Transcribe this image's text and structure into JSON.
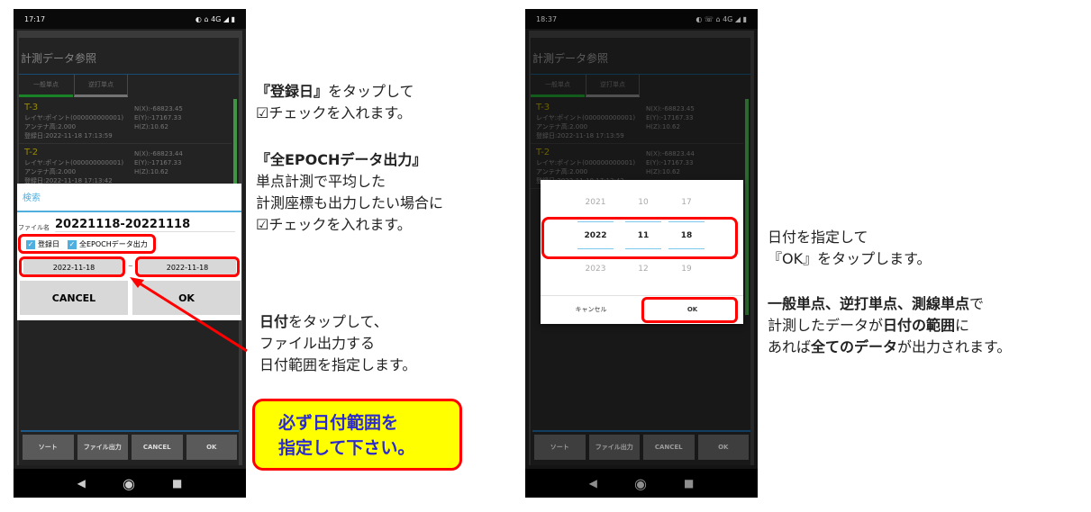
{
  "phones": [
    {
      "time": "17:17",
      "status_right": "◐ ⌂ 4G ◢ ▮"
    },
    {
      "time": "18:37",
      "status_right": "◐ ☏ ⌂ 4G ◢ ▮"
    }
  ],
  "app": {
    "title": "計測データ参照",
    "tabs": [
      "一般単点",
      "逆打単点"
    ],
    "items": [
      {
        "name": "T-3",
        "layer": "レイヤ:ポイント(000000000001)",
        "antenna": "アンテナ高:2.000",
        "date": "登録日:2022-11-18 17:13:59",
        "n": "N(X):-68823.45",
        "e": "E(Y):-17167.33",
        "h": "H(Z):10.62"
      },
      {
        "name": "T-2",
        "layer": "レイヤ:ポイント(000000000001)",
        "antenna": "アンテナ高:2.000",
        "date": "登録日:2022-11-18 17:13:42",
        "n": "N(X):-68823.44",
        "e": "E(Y):-17167.33",
        "h": "H(Z):10.62"
      }
    ],
    "bottom_buttons": [
      "ソート",
      "ファイル出力",
      "CANCEL",
      "OK"
    ]
  },
  "search_dialog": {
    "title": "検索",
    "filename_label": "ファイル名",
    "filename": "20221118-20221118",
    "check_date": "登録日",
    "check_epoch": "全EPOCHデータ出力",
    "date_from": "2022-11-18",
    "tilde": "~",
    "date_to": "2022-11-18",
    "cancel": "CANCEL",
    "ok": "OK"
  },
  "date_picker": {
    "prev": [
      "2021",
      "10",
      "17"
    ],
    "selected": [
      "2022",
      "11",
      "18"
    ],
    "next": [
      "2023",
      "12",
      "19"
    ],
    "cancel": "キャンセル",
    "ok": "OK"
  },
  "notes": {
    "n1a": "『登録日』",
    "n1b": "をタップして",
    "n1c": "☑チェックを入れます。",
    "n2a": "『全EPOCHデータ出力』",
    "n2b": "単点計測で平均した",
    "n2c": "計測座標も出力したい場合に",
    "n2d": "☑チェックを入れます。",
    "n3a": "日付",
    "n3b": "をタップして、",
    "n3c": "ファイル出力する",
    "n3d": "日付範囲を指定します。",
    "warn1": "必ず日付範囲を",
    "warn2": "指定して下さい。",
    "r1": "日付を指定して",
    "r2": "『OK』をタップします。",
    "r3a": "一般単点、逆打単点、測線単点",
    "r3b": "で",
    "r4a": "計測したデータが",
    "r4b": "日付の範囲",
    "r4c": "に",
    "r5a": "あれば",
    "r5b": "全てのデータ",
    "r5c": "が出力されます。"
  },
  "colors": {
    "highlight": "#ff0000",
    "warning_bg": "#ffff00",
    "warning_text": "#2a2ad0",
    "accent": "#4fb0e0"
  }
}
